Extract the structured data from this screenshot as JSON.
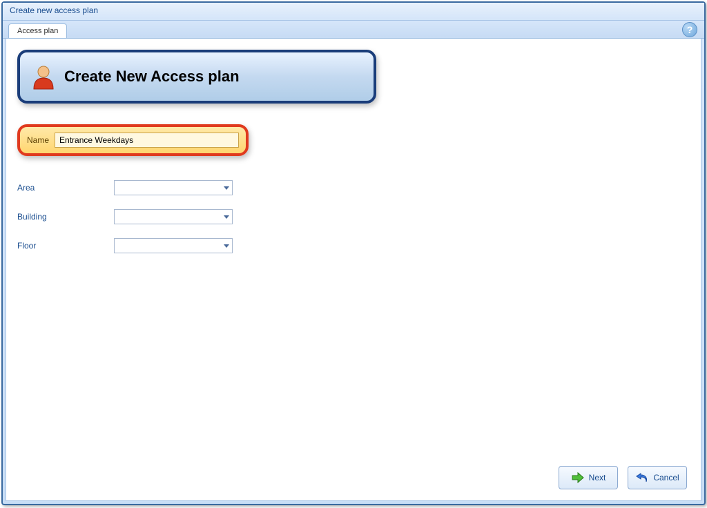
{
  "window": {
    "title": "Create new access plan"
  },
  "tabs": {
    "access_plan": "Access plan"
  },
  "header": {
    "title": "Create New Access plan"
  },
  "form": {
    "name_label": "Name",
    "name_value": "Entrance Weekdays",
    "area_label": "Area",
    "area_value": "",
    "building_label": "Building",
    "building_value": "",
    "floor_label": "Floor",
    "floor_value": ""
  },
  "buttons": {
    "next": "Next",
    "cancel": "Cancel"
  },
  "help": {
    "symbol": "?"
  }
}
